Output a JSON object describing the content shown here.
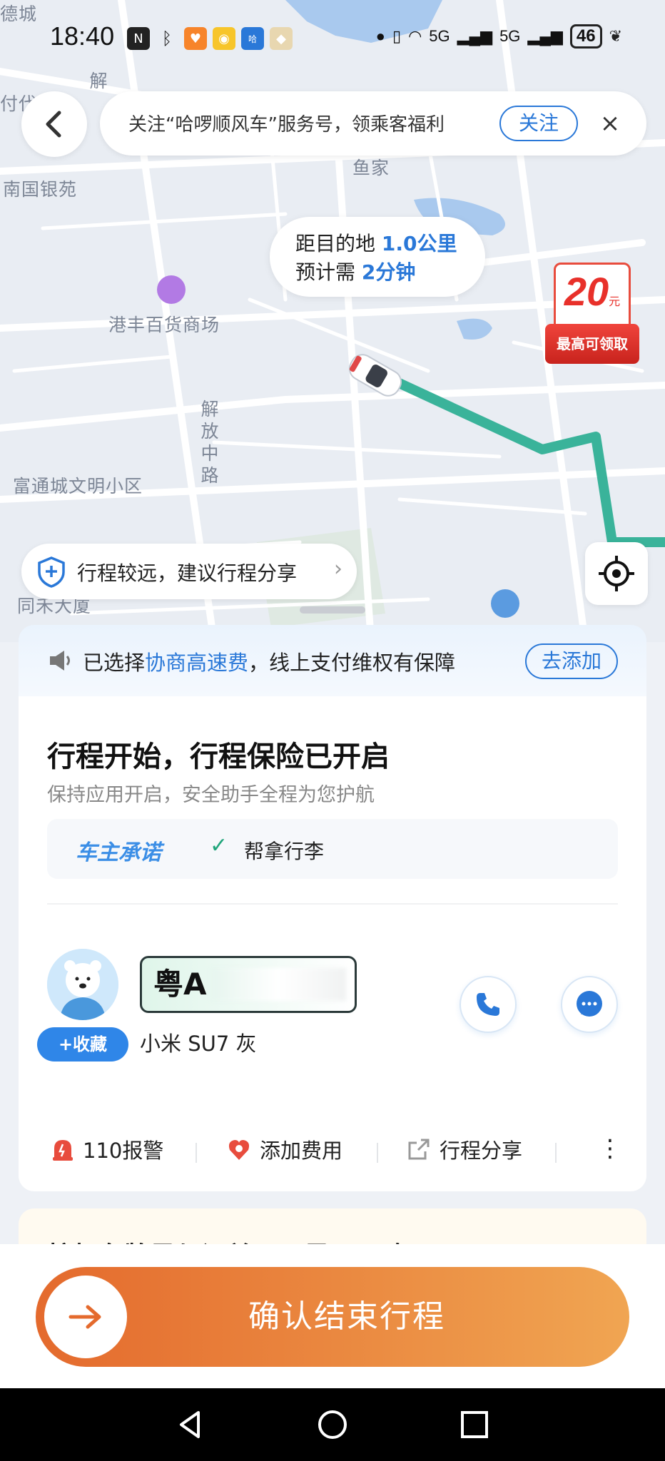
{
  "status_bar": {
    "time": "18:40",
    "battery": "46",
    "network": "5G"
  },
  "header": {
    "follow_text": "关注“哈啰顺风车”服务号，领乘客福利",
    "follow_button": "关注",
    "close": "×"
  },
  "map": {
    "labels": [
      "德城",
      "付代",
      "南国银苑",
      "鱼家",
      "港丰百货商场",
      "解放中路",
      "富通城文明小区",
      "同禾大厦",
      "解"
    ],
    "distance_line1_prefix": "距目的地",
    "distance_value": "1.0公里",
    "distance_line2_prefix": "预计需",
    "time_value": "2分钟",
    "coupon_amount": "20",
    "coupon_unit": "元",
    "coupon_label": "最高可领取",
    "share_suggestion": "行程较远，建议行程分享"
  },
  "notice": {
    "prefix": "已选择",
    "highlight": "协商高速费",
    "suffix": "，线上支付维权有保障",
    "button": "去添加"
  },
  "trip_card": {
    "title": "行程开始，行程保险已开启",
    "subtitle": "保持应用开启，安全助手全程为您护航",
    "promise_brand": "车主承诺",
    "promise_item": "帮拿行李",
    "plate_prefix": "粤A",
    "car_model": "小米 SU7 灰",
    "favorite_button": "+收藏",
    "actions": [
      {
        "label": "110报警",
        "icon": "alarm-icon"
      },
      {
        "label": "添加费用",
        "icon": "fee-icon"
      },
      {
        "label": "行程分享",
        "icon": "share-icon"
      }
    ]
  },
  "next_card": {
    "text": "核架车牌是与订单显示是否一致?"
  },
  "bottom": {
    "confirm_button": "确认结束行程"
  },
  "colors": {
    "accent": "#2a78d8",
    "route": "#3ab39a",
    "confirm_start": "#e46a2d",
    "confirm_end": "#f0a552"
  }
}
